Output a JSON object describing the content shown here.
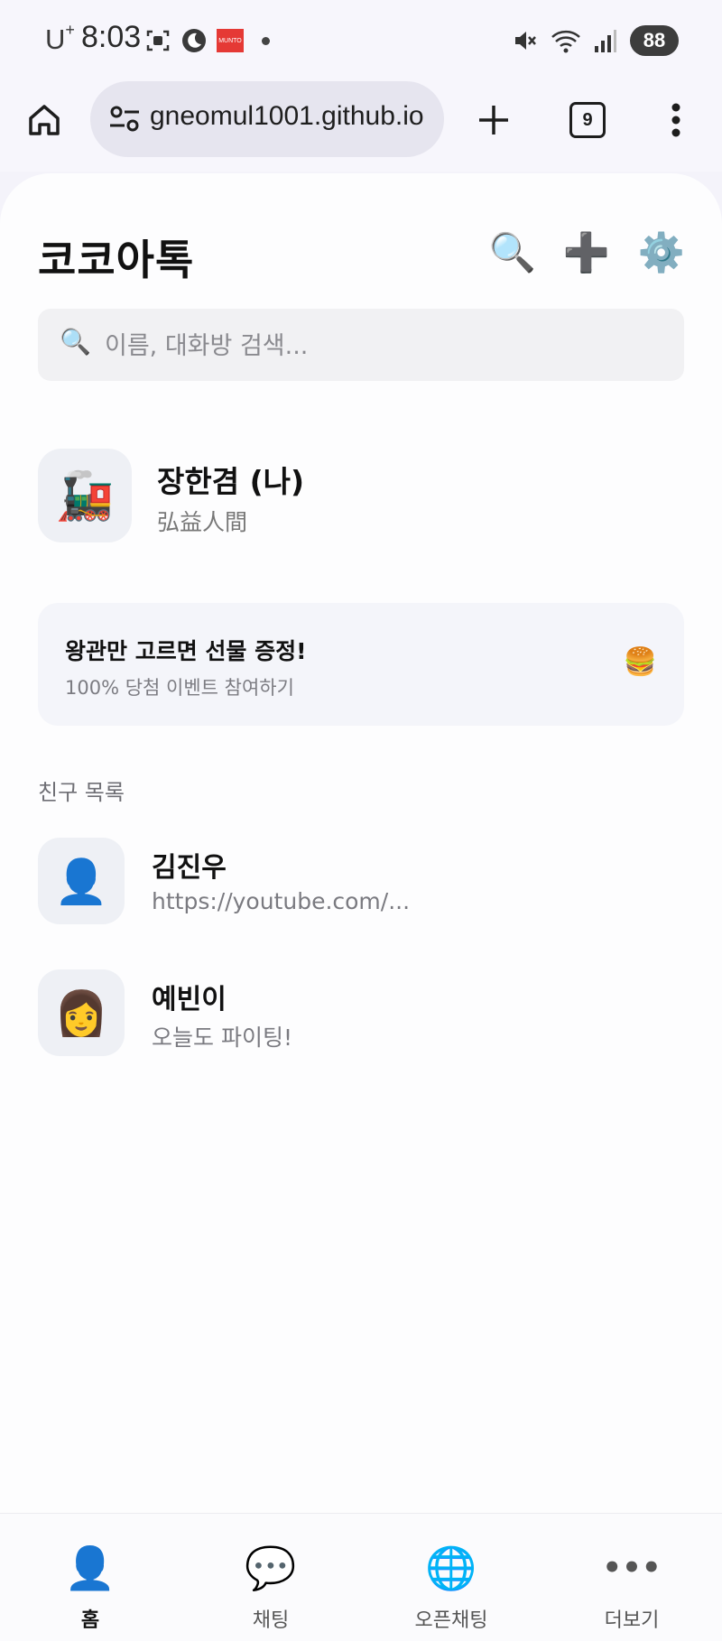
{
  "status_bar": {
    "carrier": "U",
    "carrier_sup": "+",
    "time": "8:03",
    "notification_badge": "MUNTO",
    "battery": "88"
  },
  "browser": {
    "url": "gneomul1001.github.io",
    "tab_count": "9"
  },
  "app": {
    "title": "코코아톡",
    "header_icons": [
      "search-icon",
      "add-icon",
      "settings-icon"
    ],
    "search_placeholder": "이름, 대화방 검색...",
    "profile": {
      "avatar": "🚂",
      "name": "장한겸 (나)",
      "status": "弘益人間"
    },
    "banner": {
      "title": "왕관만 고르면 선물 증정!",
      "subtitle": "100% 당첨 이벤트 참여하기",
      "icon": "🍔"
    },
    "friends_section_label": "친구 목록",
    "friends": [
      {
        "avatar": "👤",
        "name": "김진우",
        "message": "https://youtube.com/..."
      },
      {
        "avatar": "👩",
        "name": "예빈이",
        "message": "오늘도 파이팅!"
      }
    ]
  },
  "bottom_nav": {
    "active": "홈",
    "items": [
      {
        "icon": "👤",
        "label": "홈"
      },
      {
        "icon": "💬",
        "label": "채팅"
      },
      {
        "icon": "🌐",
        "label": "오픈채팅"
      },
      {
        "icon": "•••",
        "label": "더보기"
      }
    ]
  }
}
